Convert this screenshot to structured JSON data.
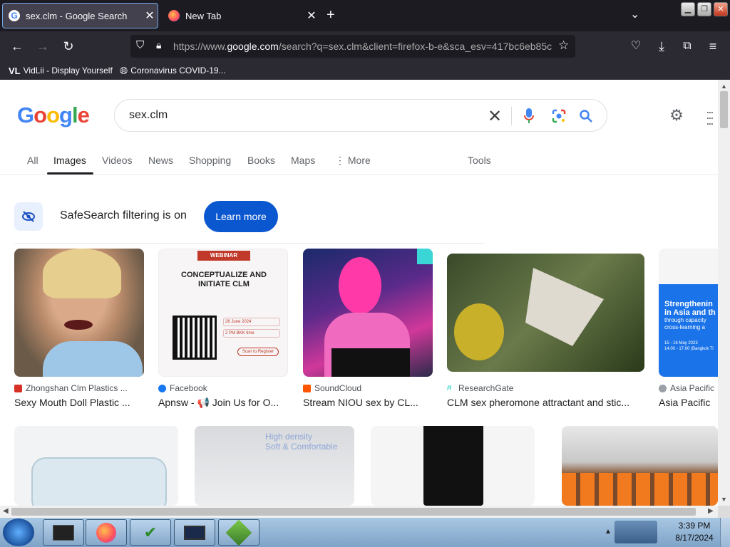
{
  "browser": {
    "tabs": [
      {
        "title": "sex.clm - Google Search",
        "active": true
      },
      {
        "title": "New Tab",
        "active": false
      }
    ],
    "url_prefix": "https://www.",
    "url_domain": "google.com",
    "url_rest": "/search?q=sex.clm&client=firefox-b-e&sca_esv=417bc6eb85c",
    "bookmarks": [
      "VidLii - Display Yourself",
      "Coronavirus COVID-19..."
    ]
  },
  "google": {
    "logo": "Google",
    "query": "sex.clm",
    "tabs": [
      "All",
      "Images",
      "Videos",
      "News",
      "Shopping",
      "Books",
      "Maps",
      "More",
      "Tools"
    ],
    "safesearch_text": "SafeSearch filtering is on",
    "learn_more": "Learn more",
    "results": [
      {
        "source": "Zhongshan Clm Plastics ...",
        "caption": "Sexy Mouth Doll Plastic ...",
        "source_color": "#d93025"
      },
      {
        "source": "Facebook",
        "caption": "Apnsw - 📢 Join Us for O...",
        "source_color": "#1877f2"
      },
      {
        "source": "SoundCloud",
        "caption": "Stream NIOU sex by CL...",
        "source_color": "#ff5500"
      },
      {
        "source": "ResearchGate",
        "caption": "CLM sex pheromone attractant and stic...",
        "source_color": "#00ccbb"
      },
      {
        "source": "Asia Pacific",
        "caption": "Asia Pacific",
        "source_color": "#9aa0a6"
      }
    ],
    "webinar": {
      "badge": "WEBINAR",
      "heading": "CONCEPTUALIZE AND INITIATE CLM",
      "date": "26 June 2024",
      "time": "2 PM BKK time",
      "cta": "Scan to Register"
    },
    "asia_card": {
      "line1": "Strengthenin",
      "line2": "in Asia and th",
      "line3": "through capacity",
      "line4": "cross-learning a",
      "dates": "15 - 16 May 2023",
      "time": "14:00 - 17:00 (Bangkok Ti"
    },
    "row2_text": {
      "line1": "High density",
      "line2": "Soft & Comfortable"
    }
  },
  "taskbar": {
    "time": "3:39 PM",
    "date": "8/17/2024"
  }
}
